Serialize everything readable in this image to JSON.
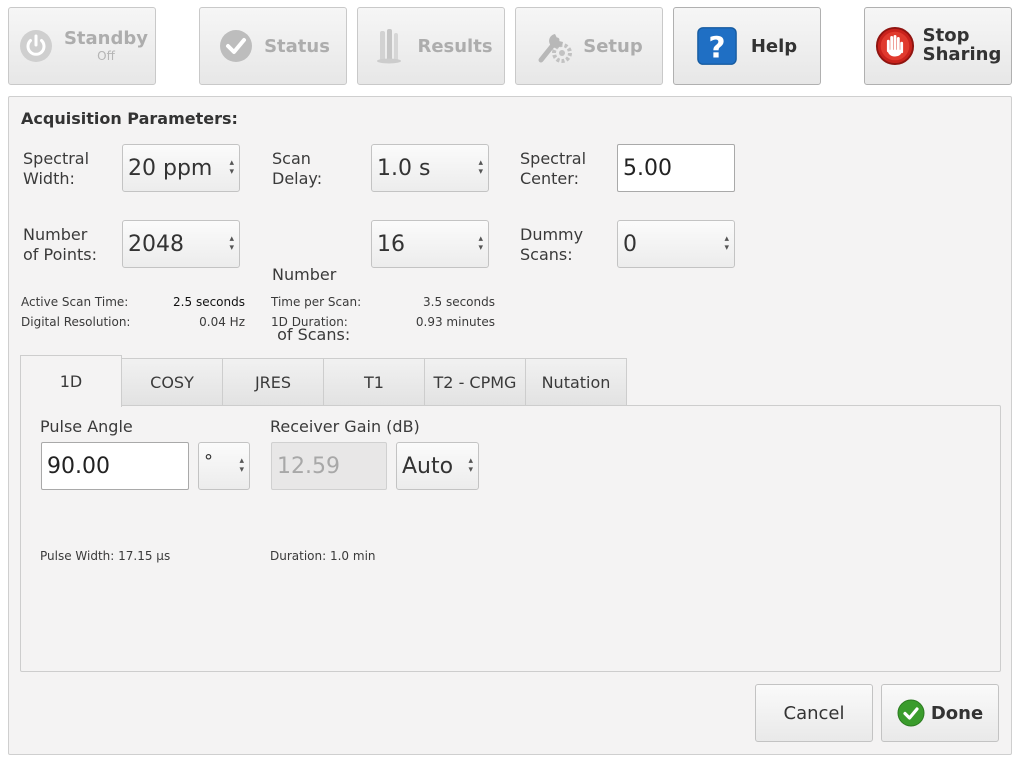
{
  "toolbar": {
    "standby": {
      "label": "Standby",
      "sub": "Off",
      "icon": "power-icon",
      "enabled": false
    },
    "status": {
      "label": "Status",
      "icon": "checkmark-icon",
      "enabled": false
    },
    "results": {
      "label": "Results",
      "icon": "results-icon",
      "enabled": false
    },
    "setup": {
      "label": "Setup",
      "icon": "wrench-gear-icon",
      "enabled": false
    },
    "help": {
      "label": "Help",
      "icon": "question-icon",
      "enabled": true
    },
    "stop_sharing": {
      "line1": "Stop",
      "line2": "Sharing",
      "icon": "stop-hand-icon",
      "enabled": true
    }
  },
  "acquisition": {
    "title": "Acquisition Parameters:",
    "spectral_width": {
      "label1": "Spectral",
      "label2": "Width:",
      "value": "20 ppm"
    },
    "scan_delay": {
      "label1": "Scan",
      "label2": "Delay:",
      "value": "1.0 s"
    },
    "spectral_center": {
      "label1": "Spectral",
      "label2": "Center:",
      "value": "5.00"
    },
    "number_of_points": {
      "label1": "Number",
      "label2": "of Points:",
      "value": "2048"
    },
    "number_of_scans": {
      "label1": "Number",
      "label2": " of Scans:",
      "value": "16"
    },
    "dummy_scans": {
      "label1": "Dummy",
      "label2": "Scans:",
      "value": "0"
    },
    "info": {
      "active_scan_time": {
        "label": "Active Scan Time:",
        "value": "2.5 seconds"
      },
      "digital_resolution": {
        "label": "Digital Resolution:",
        "value": "0.04 Hz"
      },
      "time_per_scan": {
        "label": "Time per Scan:",
        "value": "3.5 seconds"
      },
      "duration_1d": {
        "label": "1D Duration:",
        "value": "0.93 minutes"
      }
    }
  },
  "tabs": [
    {
      "label": "1D",
      "active": true
    },
    {
      "label": "COSY",
      "active": false
    },
    {
      "label": "JRES",
      "active": false
    },
    {
      "label": "T1",
      "active": false
    },
    {
      "label": "T2 - CPMG",
      "active": false
    },
    {
      "label": "Nutation",
      "active": false
    }
  ],
  "tab_1d": {
    "pulse_angle": {
      "label": "Pulse Angle",
      "value": "90.00",
      "unit": "°"
    },
    "receiver_gain": {
      "label": "Receiver Gain (dB)",
      "value": "12.59",
      "mode": "Auto"
    },
    "pulse_width_note": "Pulse Width: 17.15 μs",
    "duration_note": "Duration: 1.0 min"
  },
  "footer": {
    "cancel": "Cancel",
    "done": "Done"
  },
  "colors": {
    "help_blue": "#1f6fc4",
    "stop_red": "#c9221c",
    "done_green": "#3a9c2c",
    "disabled_text": "#adadad"
  }
}
